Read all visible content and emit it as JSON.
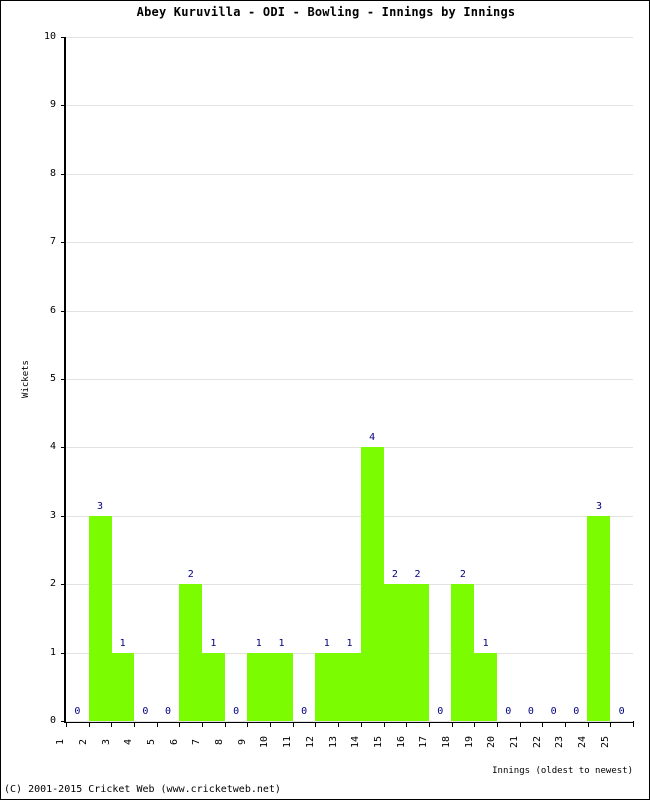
{
  "chart_data": {
    "type": "bar",
    "title": "Abey Kuruvilla - ODI - Bowling - Innings by Innings",
    "xlabel": "Innings (oldest to newest)",
    "ylabel": "Wickets",
    "categories": [
      "1",
      "2",
      "3",
      "4",
      "5",
      "6",
      "7",
      "8",
      "9",
      "10",
      "11",
      "12",
      "13",
      "14",
      "15",
      "16",
      "17",
      "18",
      "19",
      "20",
      "21",
      "22",
      "23",
      "24",
      "25"
    ],
    "values": [
      0,
      3,
      1,
      0,
      0,
      2,
      1,
      0,
      1,
      1,
      0,
      1,
      1,
      4,
      2,
      2,
      0,
      2,
      1,
      0,
      0,
      0,
      0,
      3,
      0
    ],
    "value_labels": [
      "0",
      "3",
      "1",
      "0",
      "0",
      "2",
      "1",
      "0",
      "1",
      "1",
      "0",
      "1",
      "1",
      "4",
      "2",
      "2",
      "0",
      "2",
      "1",
      "0",
      "0",
      "0",
      "0",
      "3",
      "0"
    ],
    "ylim": [
      0,
      10
    ],
    "yticks": [
      "0",
      "1",
      "2",
      "3",
      "4",
      "5",
      "6",
      "7",
      "8",
      "9",
      "10"
    ],
    "grid": true,
    "legend": "none",
    "bar_color": "#7CFC00",
    "value_label_color": "#000080",
    "gridline_color": "#E2E2E2",
    "axis_color": "#000000"
  },
  "footer": {
    "copyright": "(C) 2001-2015 Cricket Web (www.cricketweb.net)"
  }
}
